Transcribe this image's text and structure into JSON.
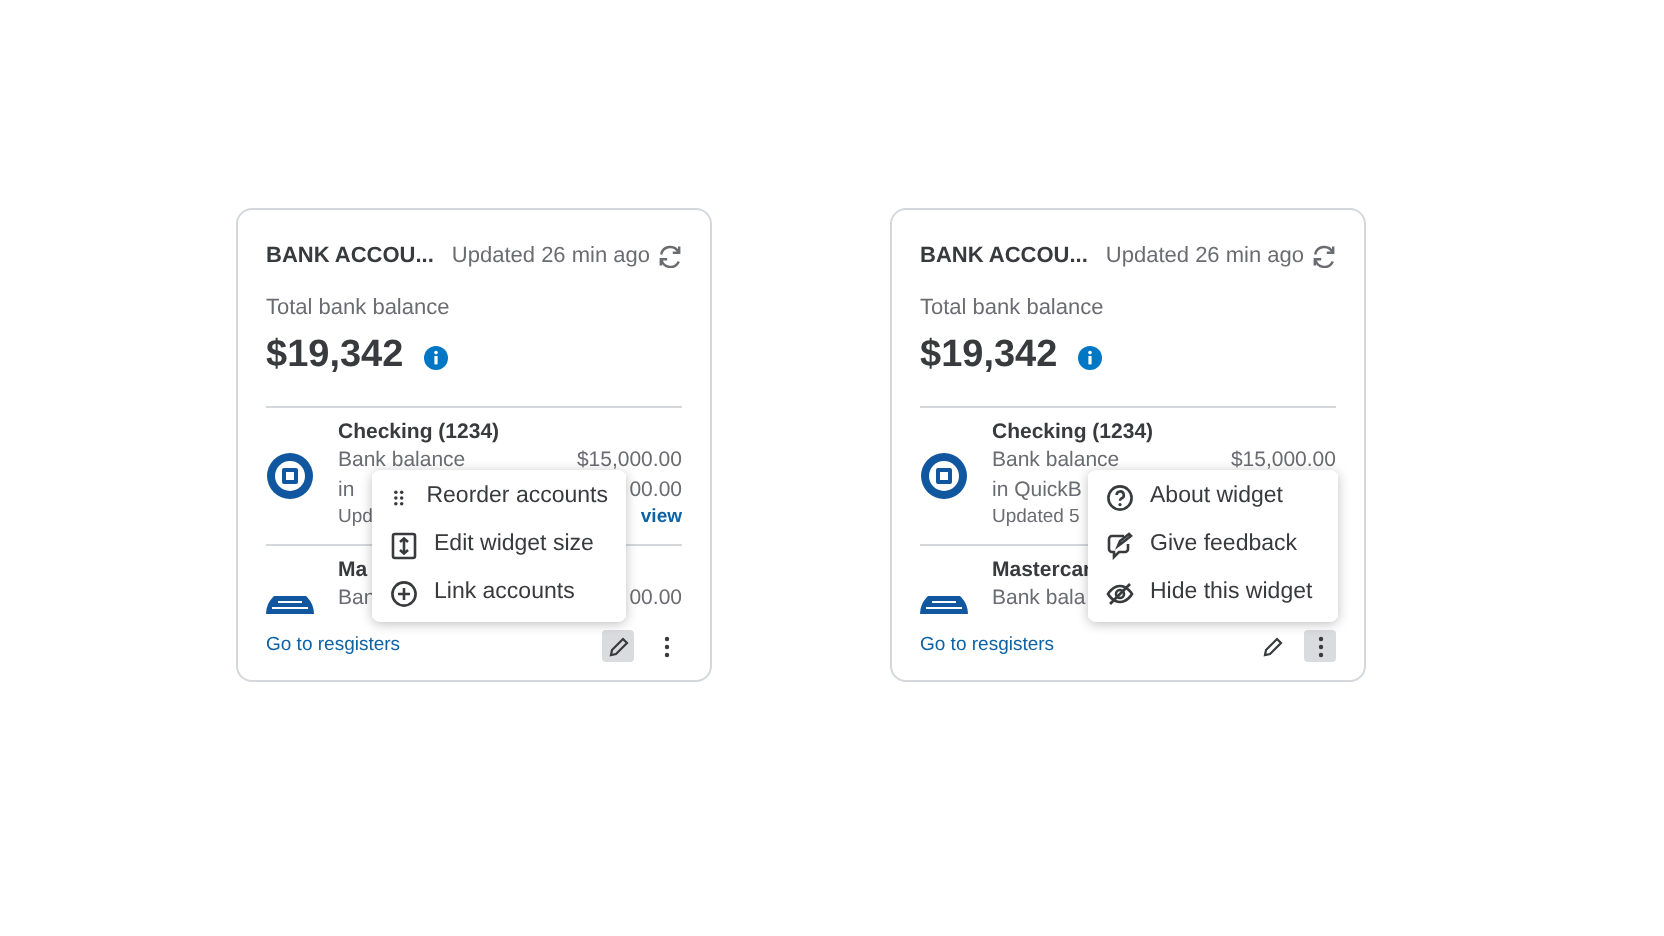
{
  "cards": [
    {
      "title": "BANK ACCOU...",
      "updated": "Updated 26 min ago",
      "balance_label": "Total bank balance",
      "balance": "$19,342",
      "accounts": [
        {
          "name": "Checking (1234)",
          "lines": [
            {
              "label": "Bank balance",
              "amount": "$15,000.00"
            },
            {
              "label": "in",
              "amount": "00.00"
            }
          ],
          "updated": "Upd",
          "link": "view"
        },
        {
          "name": "Ma",
          "lines": [
            {
              "label": "Ban",
              "amount": "00.00"
            }
          ]
        }
      ],
      "footer_link": "Go to resgisters",
      "edit_active": true,
      "more_active": false,
      "menu": [
        {
          "label": "Reorder accounts"
        },
        {
          "label": "Edit widget size"
        },
        {
          "label": "Link accounts"
        }
      ]
    },
    {
      "title": "BANK ACCOU...",
      "updated": "Updated 26 min ago",
      "balance_label": "Total bank balance",
      "balance": "$19,342",
      "accounts": [
        {
          "name": "Checking (1234)",
          "lines": [
            {
              "label": "Bank balance",
              "amount": "$15,000.00"
            },
            {
              "label": "in QuickB"
            }
          ],
          "updated": "Updated 5"
        },
        {
          "name": "Mastercar",
          "lines": [
            {
              "label": "Bank bala"
            }
          ]
        }
      ],
      "footer_link": "Go to resgisters",
      "edit_active": false,
      "more_active": true,
      "menu": [
        {
          "label": "About widget"
        },
        {
          "label": "Give feedback"
        },
        {
          "label": "Hide this widget"
        }
      ]
    }
  ]
}
